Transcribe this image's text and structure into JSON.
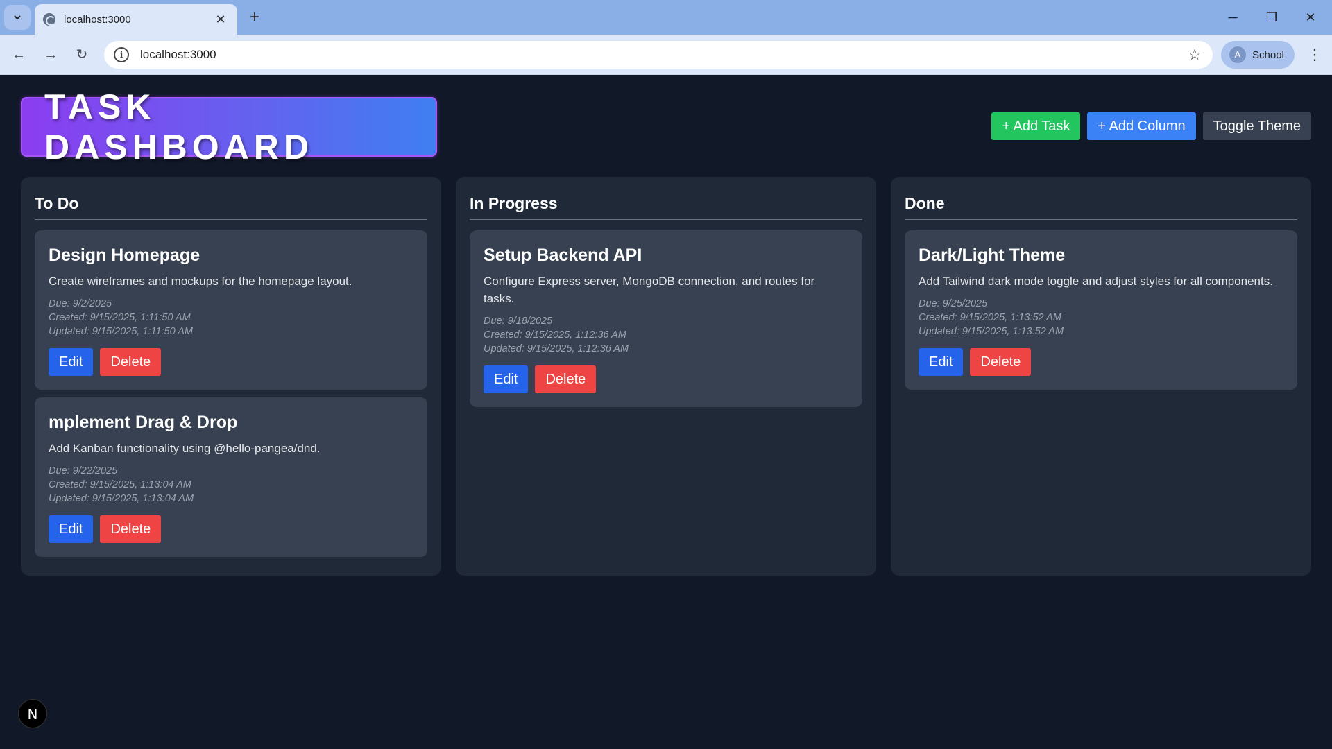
{
  "browser": {
    "tab_title": "localhost:3000",
    "url": "localhost:3000",
    "profile_initial": "A",
    "profile_name": "School",
    "icons": {
      "tab_search": "chevron-down-icon",
      "close": "close-icon",
      "new_tab": "plus-icon",
      "back": "back-arrow-icon",
      "forward": "forward-arrow-icon",
      "reload": "reload-icon",
      "site_info": "info-icon",
      "bookmark": "star-icon",
      "menu": "kebab-menu-icon"
    }
  },
  "header": {
    "title": "TASK DASHBOARD",
    "add_task_label": "+ Add Task",
    "add_column_label": "+ Add Column",
    "toggle_theme_label": "Toggle Theme"
  },
  "columns": [
    {
      "title": "To Do",
      "tasks": [
        {
          "title": "Design Homepage",
          "description": "Create wireframes and mockups for the homepage layout.",
          "due": "Due: 9/2/2025",
          "created": "Created: 9/15/2025, 1:11:50 AM",
          "updated": "Updated: 9/15/2025, 1:11:50 AM",
          "edit_label": "Edit",
          "delete_label": "Delete"
        },
        {
          "title": "mplement Drag & Drop",
          "description": "Add Kanban functionality using @hello-pangea/dnd.",
          "due": "Due: 9/22/2025",
          "created": "Created: 9/15/2025, 1:13:04 AM",
          "updated": "Updated: 9/15/2025, 1:13:04 AM",
          "edit_label": "Edit",
          "delete_label": "Delete"
        }
      ]
    },
    {
      "title": "In Progress",
      "tasks": [
        {
          "title": "Setup Backend API",
          "description": "Configure Express server, MongoDB connection, and routes for tasks.",
          "due": "Due: 9/18/2025",
          "created": "Created: 9/15/2025, 1:12:36 AM",
          "updated": "Updated: 9/15/2025, 1:12:36 AM",
          "edit_label": "Edit",
          "delete_label": "Delete"
        }
      ]
    },
    {
      "title": "Done",
      "tasks": [
        {
          "title": "Dark/Light Theme",
          "description": "Add Tailwind dark mode toggle and adjust styles for all components.",
          "due": "Due: 9/25/2025",
          "created": "Created: 9/15/2025, 1:13:52 AM",
          "updated": "Updated: 9/15/2025, 1:13:52 AM",
          "edit_label": "Edit",
          "delete_label": "Delete"
        }
      ]
    }
  ],
  "dev_badge": "N",
  "colors": {
    "page_bg": "#111827",
    "column_bg": "#1f2937",
    "card_bg": "#374151",
    "add_task": "#22c55e",
    "add_column": "#3b82f6",
    "toggle_theme": "#374151",
    "edit": "#2563eb",
    "delete": "#ef4444"
  }
}
